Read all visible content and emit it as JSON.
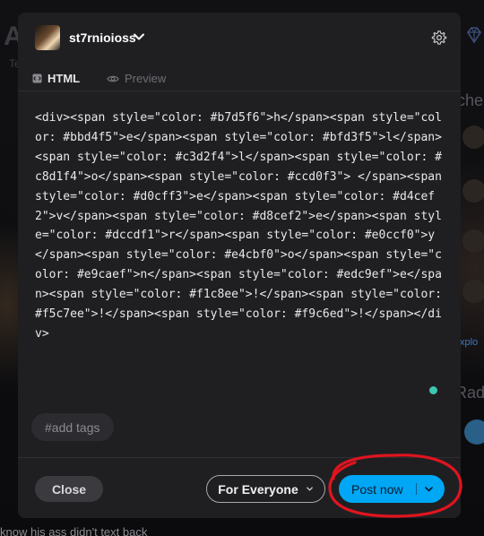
{
  "background": {
    "partial_texts": [
      "A",
      "Te",
      "che",
      "xplo",
      "Rada"
    ],
    "bottom_text": "know his ass didn't text back"
  },
  "modal": {
    "header": {
      "username": "st7rnioioss",
      "avatar_icon": "profile-avatar",
      "chevron_icon": "chevron-down-icon",
      "settings_icon": "gear-icon"
    },
    "tabs": [
      {
        "label": "HTML",
        "icon": "html-icon",
        "active": true
      },
      {
        "label": "Preview",
        "icon": "eye-icon",
        "active": false
      }
    ],
    "editor": {
      "code": "<div><span style=\"color: #b7d5f6\">h</span><span style=\"color: #bbd4f5\">e</span><span style=\"color: #bfd3f5\">l</span><span style=\"color: #c3d2f4\">l</span><span style=\"color: #c8d1f4\">o</span><span style=\"color: #ccd0f3\"> </span><span style=\"color: #d0cff3\">e</span><span style=\"color: #d4cef2\">v</span><span style=\"color: #d8cef2\">e</span><span style=\"color: #dccdf1\">r</span><span style=\"color: #e0ccf0\">y</span><span style=\"color: #e4cbf0\">o</span><span style=\"color: #e9caef\">n</span><span style=\"color: #edc9ef\">e</span><span style=\"color: #f1c8ee\">!</span><span style=\"color: #f5c7ee\">!</span><span style=\"color: #f9c6ed\">!</span></div>"
    },
    "tags_placeholder": "#add tags",
    "footer": {
      "close_label": "Close",
      "audience_label": "For Everyone",
      "post_label": "Post now"
    }
  },
  "colors": {
    "accent": "#00a7f5",
    "modal_bg": "#1f1f22",
    "annotation_circle": "#e0141e"
  }
}
